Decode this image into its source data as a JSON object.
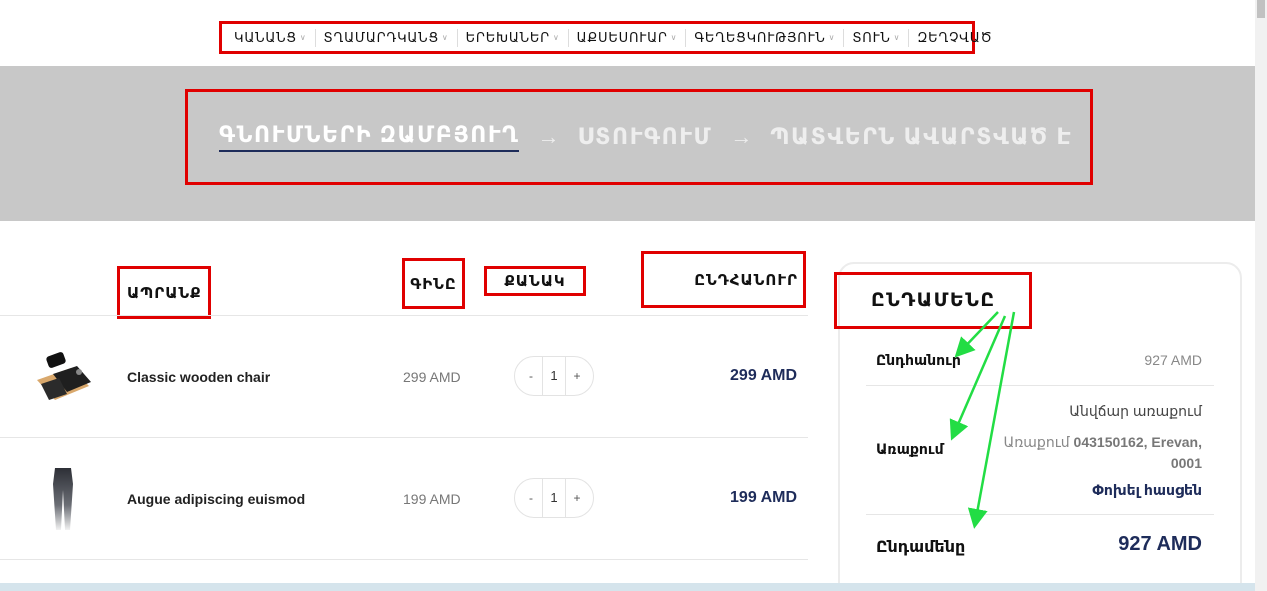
{
  "nav": {
    "items": [
      {
        "label": "Կանանց",
        "has_dropdown": true
      },
      {
        "label": "Տղամարդկանց",
        "has_dropdown": true
      },
      {
        "label": "Երեխաներ",
        "has_dropdown": true
      },
      {
        "label": "Աքսեսուար",
        "has_dropdown": true
      },
      {
        "label": "Գեղեցկություն",
        "has_dropdown": true
      },
      {
        "label": "Տուն",
        "has_dropdown": true
      },
      {
        "label": "Զեղչված",
        "has_dropdown": false
      }
    ]
  },
  "steps": {
    "items": [
      {
        "label": "Գնումների զամբյուղ",
        "active": true
      },
      {
        "label": "Ստուգում",
        "active": false
      },
      {
        "label": "Պատվերն ավարտված է",
        "active": false
      }
    ],
    "separator": "→"
  },
  "cart": {
    "headers": {
      "product": "Ապրանք",
      "price": "Գինը",
      "quantity": "Քանակ",
      "subtotal": "Ընդհանուր"
    },
    "rows": [
      {
        "name": "Classic wooden chair",
        "price": "299 AMD",
        "quantity": "1",
        "subtotal": "299 AMD",
        "thumb": "accessories-set-thumbnail"
      },
      {
        "name": "Augue adipiscing euismod",
        "price": "199 AMD",
        "quantity": "1",
        "subtotal": "199 AMD",
        "thumb": "leggings-thumbnail"
      }
    ],
    "minus": "-",
    "plus": "+"
  },
  "totals": {
    "title": "Ընդամենը",
    "subtotal_label": "Ընդհանուր",
    "subtotal_value": "927 AMD",
    "shipping_label": "Առաքում",
    "shipping_method": "Անվճար առաքում",
    "shipping_prefix": "Առաքում ",
    "shipping_address_bold": "043150162, Erevan, 0001",
    "change_address": "Փոխել հասցեն",
    "total_label": "Ընդամենը",
    "total_value": "927 AMD"
  },
  "colors": {
    "annotation_red": "#e00000",
    "annotation_green": "#22dd44",
    "brand_navy": "#1e2c5a",
    "banner_grey": "#c8c8c8"
  }
}
